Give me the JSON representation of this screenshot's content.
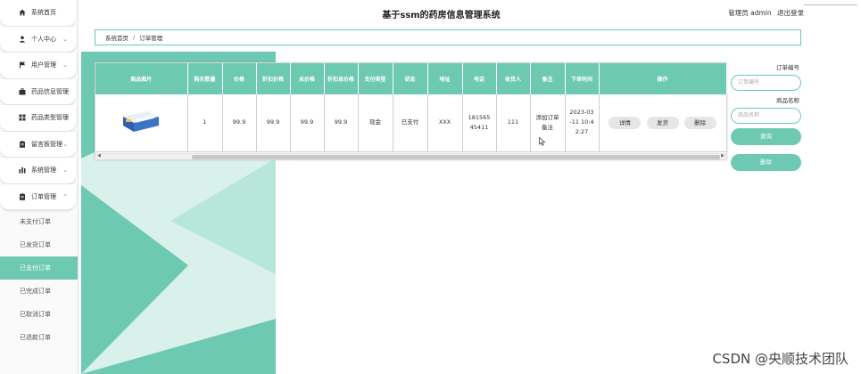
{
  "app": {
    "title": "基于ssm的药房信息管理系统",
    "user_label": "管理员 admin",
    "logout_label": "退出登录"
  },
  "sidebar": {
    "items": [
      {
        "label": "系统首页",
        "icon": "home-icon"
      },
      {
        "label": "个人中心",
        "icon": "user-icon"
      },
      {
        "label": "用户管理",
        "icon": "flag-icon"
      },
      {
        "label": "药品信息管理",
        "icon": "briefcase-icon"
      },
      {
        "label": "药品类型管理",
        "icon": "grid-icon"
      },
      {
        "label": "留言板管理",
        "icon": "clipboard-icon"
      },
      {
        "label": "系统管理",
        "icon": "bar-chart-icon"
      },
      {
        "label": "订单管理",
        "icon": "clipboard-icon"
      }
    ],
    "subitems": [
      {
        "label": "未支付订单"
      },
      {
        "label": "已发货订单"
      },
      {
        "label": "已支付订单"
      },
      {
        "label": "已完成订单"
      },
      {
        "label": "已取消订单"
      },
      {
        "label": "已退款订单"
      }
    ]
  },
  "breadcrumb": {
    "home": "系统首页",
    "separator": "/",
    "current": "订单管理"
  },
  "table": {
    "headers": [
      "商品图片",
      "购买数量",
      "价格",
      "折扣价格",
      "总价格",
      "折扣总价格",
      "支付类型",
      "状态",
      "地址",
      "电话",
      "收货人",
      "备注",
      "下单时间",
      "操作"
    ],
    "rows": [
      {
        "quantity": "1",
        "price": "99.9",
        "discount_price": "99.9",
        "total": "99.9",
        "discount_total": "99.9",
        "pay_type": "现金",
        "status": "已支付",
        "address": "XXX",
        "phone": "18156545411",
        "receiver": "111",
        "remark": "添加订单备注",
        "order_time": "2023-03-11 10:42:27",
        "actions": [
          "详情",
          "发货",
          "删除"
        ]
      }
    ]
  },
  "search": {
    "order_no_label": "订单编号",
    "order_no_placeholder": "订单编号",
    "product_name_label": "商品名称",
    "product_name_placeholder": "商品名称",
    "query_button": "查询",
    "delete_button": "删除"
  },
  "watermark": "CSDN @央顺技术团队",
  "colors": {
    "accent": "#6ec9b3",
    "accent_light": "#cdeee4"
  }
}
